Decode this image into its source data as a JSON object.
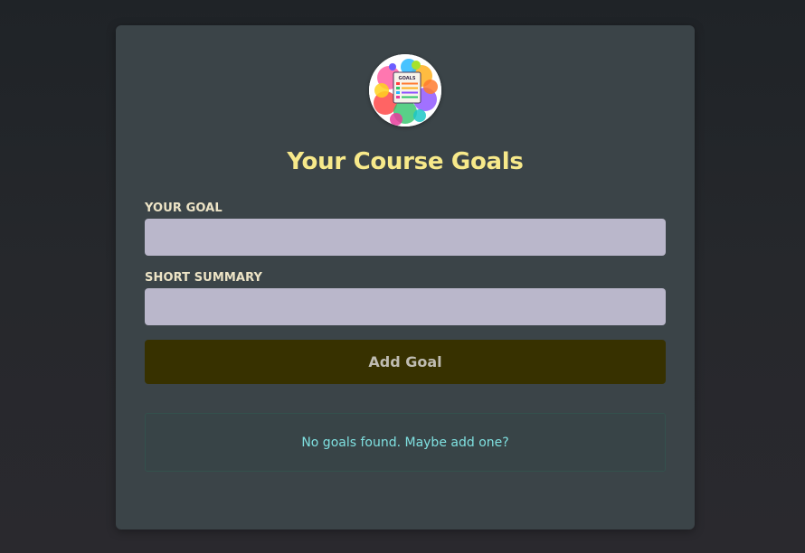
{
  "app": {
    "title": "Your Course Goals",
    "logo": {
      "icon": "goals-checklist-logo-icon",
      "badge_text": "GOALS"
    }
  },
  "form": {
    "goal_label": "YOUR GOAL",
    "goal_value": "",
    "summary_label": "SHORT SUMMARY",
    "summary_value": "",
    "submit_label": "Add Goal"
  },
  "goals": {
    "items": [],
    "empty_message": "No goals found. Maybe add one?"
  },
  "colors": {
    "page_background": "#25272b",
    "card_background": "#3b4448",
    "title": "#f7e98a",
    "label": "#ede4c6",
    "input_background": "#bab7cb",
    "button_background": "#373100",
    "button_text": "#bfbcb2",
    "empty_text": "#7fe0e0",
    "empty_border": "#34514d"
  }
}
